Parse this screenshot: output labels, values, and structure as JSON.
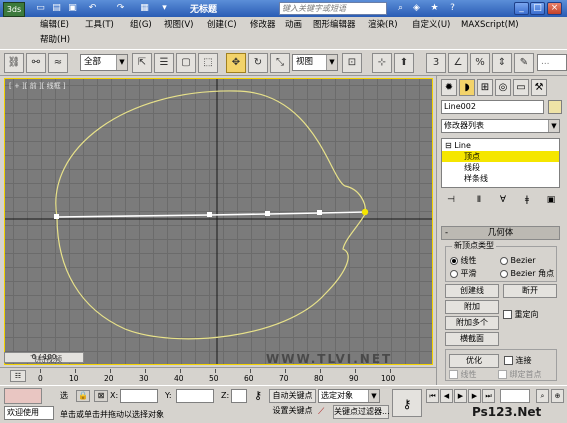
{
  "titlebar": {
    "app_icon_label": "3ds",
    "title": "无标题",
    "search_placeholder": "键入关键字或短语",
    "icons": [
      "new-icon",
      "undo-icon",
      "redo-icon",
      "help-icon"
    ]
  },
  "menu": {
    "items": [
      "编辑(E)",
      "工具(T)",
      "组(G)",
      "视图(V)",
      "创建(C)",
      "修改器",
      "动画",
      "图形编辑器",
      "渲染(R)",
      "自定义(U)",
      "MAXScript(M)",
      "帮助(H)"
    ]
  },
  "toolbar": {
    "selection_filter": "全部",
    "reference_coord": "视图"
  },
  "viewport": {
    "label": "[ + ][ 前 ][ 线框 ]",
    "shape_stroke": "#e8e28a",
    "vertex_color": "#ffffff",
    "selected_vertex_color": "#f5e600",
    "axis_color": "#1a1a1a"
  },
  "command_panel": {
    "object_name": "Line002",
    "modifier_list": "修改器列表",
    "stack": {
      "root": "Line",
      "sub_vertex": "顶点",
      "sub_segment": "线段",
      "sub_spline": "样条线"
    },
    "rollout_title": "几何体",
    "new_vertex_type_title": "新顶点类型",
    "vt_linear": "线性",
    "vt_bezier": "Bezier",
    "vt_smooth": "平滑",
    "vt_bezier_corner": "Bezier 角点",
    "btn_create_line": "创建线",
    "btn_break": "断开",
    "btn_attach": "附加",
    "chk_reorient": "重定向",
    "btn_attach_mult": "附加多个",
    "btn_cross_section": "横截面",
    "btn_refine": "优化",
    "chk_connect": "连接",
    "chk_linear": "线性",
    "chk_bind_first": "绑定首点"
  },
  "timeline": {
    "slider_label": "0 / 100",
    "ticks": [
      "0",
      "10",
      "20",
      "30",
      "40",
      "50",
      "60",
      "70",
      "80",
      "90",
      "100"
    ]
  },
  "status": {
    "selection_label": "选",
    "x_label": "X:",
    "y_label": "Y:",
    "z_label": "Z:",
    "welcome": "欢迎使用",
    "prompt": "单击或单击并拖动以选择对象",
    "auto_key": "自动关键点",
    "set_key": "设置关键点",
    "key_mode": "选定对象",
    "key_filters": "关键点过滤器..."
  },
  "watermark": {
    "left_text": "飞特视频",
    "url_text": "WWW.TLVI.NET",
    "logo_text": "Ps123.Net"
  }
}
